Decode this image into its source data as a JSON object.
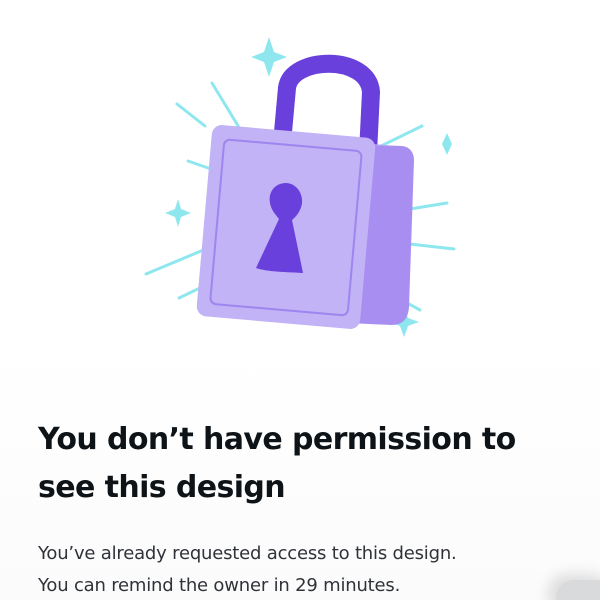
{
  "dialog": {
    "title": "You don’t have permission to see this design",
    "message_lines": [
      "You’ve already requested access to this design.",
      "You can remind the owner in 29 minutes."
    ]
  },
  "illustration": {
    "icon": "padlock-icon",
    "colors": {
      "lock_face": "#c2b2f6",
      "lock_side": "#a88ef0",
      "shackle": "#6a40dc",
      "keyhole": "#6a40dc",
      "sparkle": "#8ee7ee"
    }
  }
}
